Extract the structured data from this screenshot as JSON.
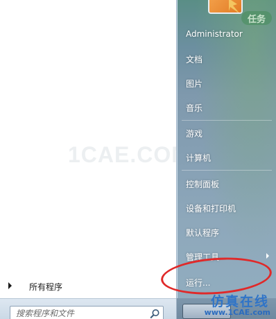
{
  "left": {
    "watermark": "1CAE.COM",
    "all_programs": "所有程序",
    "search_placeholder": "搜索程序和文件"
  },
  "right": {
    "user": "Administrator",
    "items": [
      {
        "label": "文档"
      },
      {
        "label": "图片"
      },
      {
        "label": "音乐"
      },
      {
        "label": "游戏"
      },
      {
        "label": "计算机"
      },
      {
        "label": "控制面板"
      },
      {
        "label": "设备和打印机"
      },
      {
        "label": "默认程序"
      },
      {
        "label": "管理工具"
      },
      {
        "label": "运行..."
      }
    ],
    "pill": "任务"
  },
  "brand": {
    "cn": "仿真在线",
    "url": "www.1CAE.com"
  },
  "colors": {
    "annotation_circle": "#e02929",
    "brand_blue": "#2f74c8"
  }
}
